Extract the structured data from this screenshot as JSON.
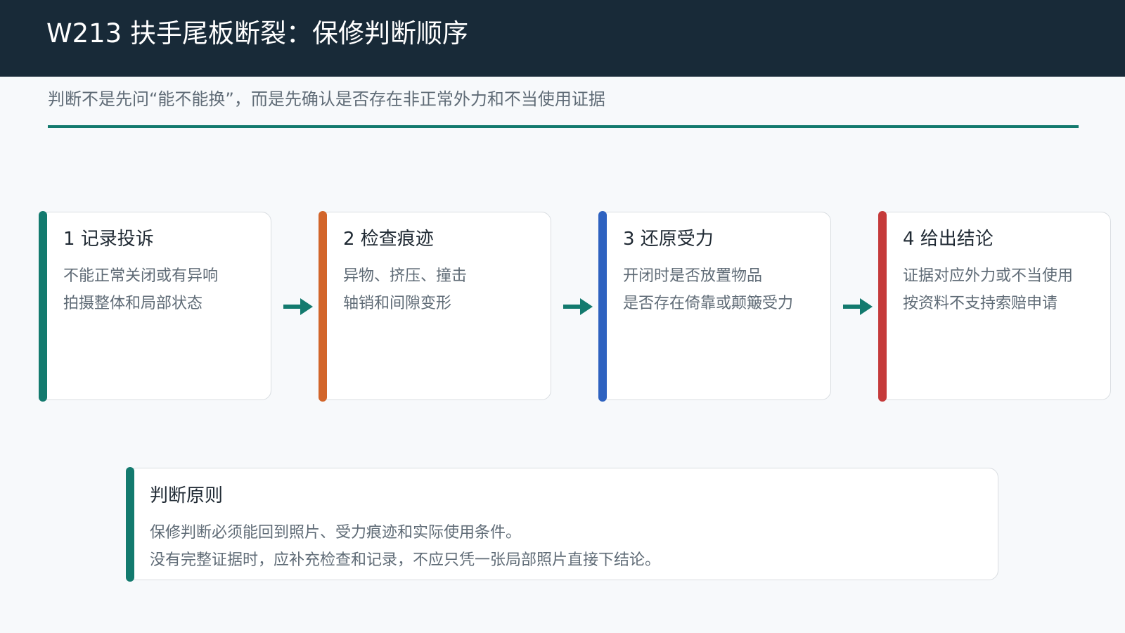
{
  "header": {
    "title": "W213 扶手尾板断裂：保修判断顺序"
  },
  "subtitle": "判断不是先问“能不能换”，而是先确认是否存在非正常外力和不当使用证据",
  "colors": {
    "header_bg": "#182a38",
    "teal": "#137a6e",
    "orange": "#d2652a",
    "blue": "#2e62c0",
    "red": "#c53a3a"
  },
  "steps": [
    {
      "title": "1 记录投诉",
      "lines": [
        "不能正常关闭或有异响",
        "拍摄整体和局部状态"
      ],
      "accent": "#137a6e"
    },
    {
      "title": "2 检查痕迹",
      "lines": [
        "异物、挤压、撞击",
        "轴销和间隙变形"
      ],
      "accent": "#d2652a"
    },
    {
      "title": "3 还原受力",
      "lines": [
        "开闭时是否放置物品",
        "是否存在倚靠或颠簸受力"
      ],
      "accent": "#2e62c0"
    },
    {
      "title": "4 给出结论",
      "lines": [
        "证据对应外力或不当使用",
        "按资料不支持索赔申请"
      ],
      "accent": "#c53a3a"
    }
  ],
  "arrow_icon": "arrow-right-icon",
  "principle": {
    "title": "判断原则",
    "lines": [
      "保修判断必须能回到照片、受力痕迹和实际使用条件。",
      "没有完整证据时，应补充检查和记录，不应只凭一张局部照片直接下结论。"
    ]
  }
}
